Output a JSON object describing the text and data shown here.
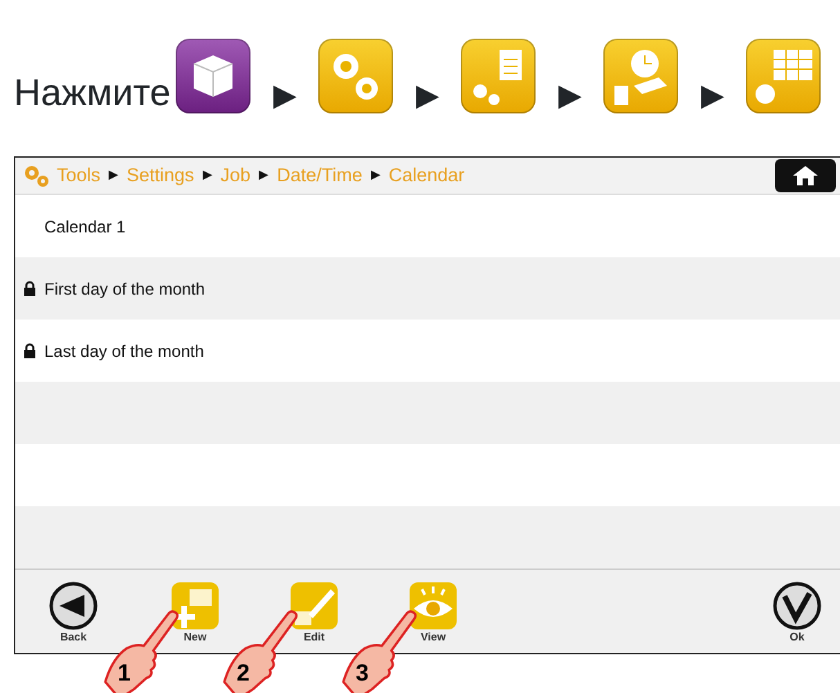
{
  "instruction": {
    "label": "Нажмите",
    "steps": [
      {
        "kind": "package"
      },
      {
        "kind": "settings",
        "arrow": "▶"
      },
      {
        "kind": "job",
        "arrow": "▶"
      },
      {
        "kind": "datetime",
        "arrow": "▶"
      },
      {
        "kind": "calendar",
        "arrow": "▶"
      }
    ]
  },
  "screen": {
    "breadcrumb": [
      {
        "label": "Tools"
      },
      {
        "separator": "▶",
        "label": "Settings"
      },
      {
        "separator": "▶",
        "label": "Job"
      },
      {
        "separator": "▶",
        "label": "Date/Time"
      },
      {
        "separator": "▶",
        "label": "Calendar"
      }
    ],
    "rows": [
      {
        "label": "Calendar 1",
        "locked": false
      },
      {
        "label": "First day of the month",
        "locked": true
      },
      {
        "label": "Last day of the month",
        "locked": true
      }
    ],
    "toolbar": [
      {
        "kind": "back",
        "label": "Back"
      },
      {
        "kind": "new",
        "label": "New",
        "callout": "1"
      },
      {
        "kind": "edit",
        "label": "Edit",
        "callout": "2"
      },
      {
        "kind": "view",
        "label": "View",
        "callout": "3"
      },
      {
        "kind": "ok",
        "label": "Ok"
      }
    ]
  }
}
